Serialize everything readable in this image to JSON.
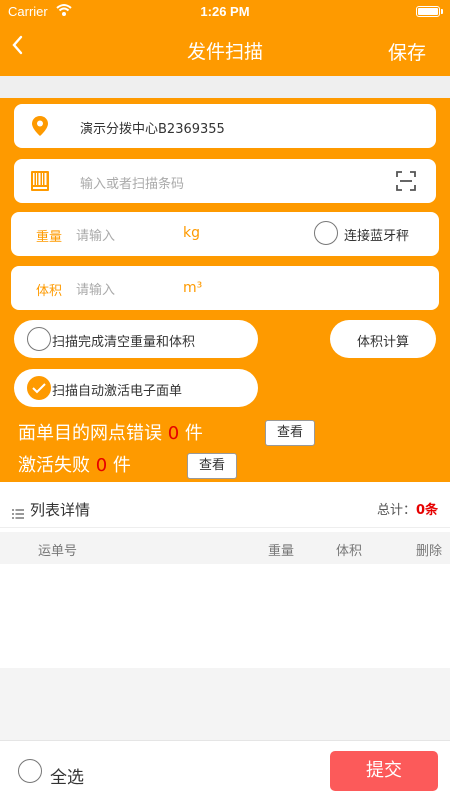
{
  "status_bar": {
    "carrier": "Carrier",
    "time": "1:26 PM"
  },
  "nav": {
    "back_icon": "chevron-left-icon",
    "title": "发件扫描",
    "save_label": "保存"
  },
  "location": {
    "icon": "location-pin-icon",
    "value": "演示分拨中心B2369355"
  },
  "barcode": {
    "icon": "barcode-icon",
    "placeholder": "输入或者扫描条码",
    "scan_icon": "scan-frame-icon"
  },
  "weight": {
    "label": "重量",
    "placeholder": "请输入",
    "unit": "kg",
    "bluetooth_label": "连接蓝牙秤",
    "bluetooth_checked": false
  },
  "volume": {
    "label": "体积",
    "placeholder": "请输入",
    "unit": "m³"
  },
  "options": {
    "clear_after_scan": {
      "label": "扫描完成清空重量和体积",
      "checked": false
    },
    "auto_activate": {
      "label": "扫描自动激活电子面单",
      "checked": true
    },
    "volume_calc_label": "体积计算"
  },
  "errors": {
    "network_error": {
      "prefix": "面单目的网点错误",
      "count": "0",
      "suffix": "件",
      "view_label": "查看"
    },
    "activate_fail": {
      "prefix": "激活失败",
      "count": "0",
      "suffix": "件",
      "view_label": "查看"
    }
  },
  "list": {
    "title": "列表详情",
    "total_label": "总计：",
    "total_count": "0条",
    "columns": [
      "运单号",
      "重量",
      "体积",
      "删除"
    ]
  },
  "footer": {
    "select_all_label": "全选",
    "select_all_checked": false,
    "submit_label": "提交"
  },
  "colors": {
    "brand": "#fe9a00",
    "submit": "#fc5a5a",
    "error_count": "#e60000"
  }
}
